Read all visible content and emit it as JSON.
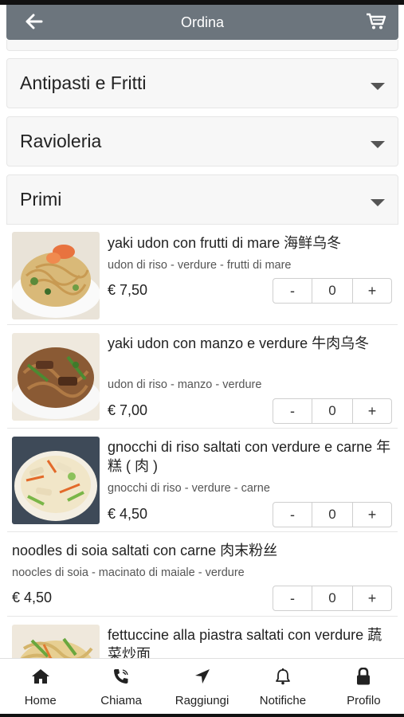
{
  "header": {
    "title": "Ordina",
    "back_icon": "arrow-left-icon",
    "cart_icon": "shopping-cart-icon"
  },
  "categories": [
    {
      "title": "Antipasti e Fritti",
      "expanded": false
    },
    {
      "title": "Ravioleria",
      "expanded": false
    },
    {
      "title": "Primi",
      "expanded": true
    }
  ],
  "items": [
    {
      "name": "yaki udon con frutti di mare 海鲜乌冬",
      "desc": "udon di riso - verdure - frutti di mare",
      "price": "€ 7,50",
      "qty": "0",
      "minus": "-",
      "plus": "+"
    },
    {
      "name": "yaki udon con manzo e verdure 牛肉乌冬",
      "desc": "udon di riso - manzo - verdure",
      "price": "€ 7,00",
      "qty": "0",
      "minus": "-",
      "plus": "+"
    },
    {
      "name": "gnocchi di riso saltati con verdure e carne 年糕 ( 肉 )",
      "desc": "gnocchi di riso - verdure - carne",
      "price": "€ 4,50",
      "qty": "0",
      "minus": "-",
      "plus": "+"
    },
    {
      "name": "noodles di soia saltati con carne 肉末粉丝",
      "desc": "noocles di soia - macinato di maiale - verdure",
      "price": "€ 4,50",
      "qty": "0",
      "minus": "-",
      "plus": "+"
    },
    {
      "name": "fettuccine alla piastra saltati con verdure 蔬菜炒面"
    }
  ],
  "nav": [
    {
      "label": "Home",
      "icon": "home-icon"
    },
    {
      "label": "Chiama",
      "icon": "phone-icon"
    },
    {
      "label": "Raggiungi",
      "icon": "location-arrow-icon"
    },
    {
      "label": "Notifiche",
      "icon": "bell-icon"
    },
    {
      "label": "Profilo",
      "icon": "lock-icon"
    }
  ],
  "colors": {
    "header_bg": "#6c757d",
    "header_text": "#ffffff",
    "panel_bg": "#f7f7f7"
  }
}
